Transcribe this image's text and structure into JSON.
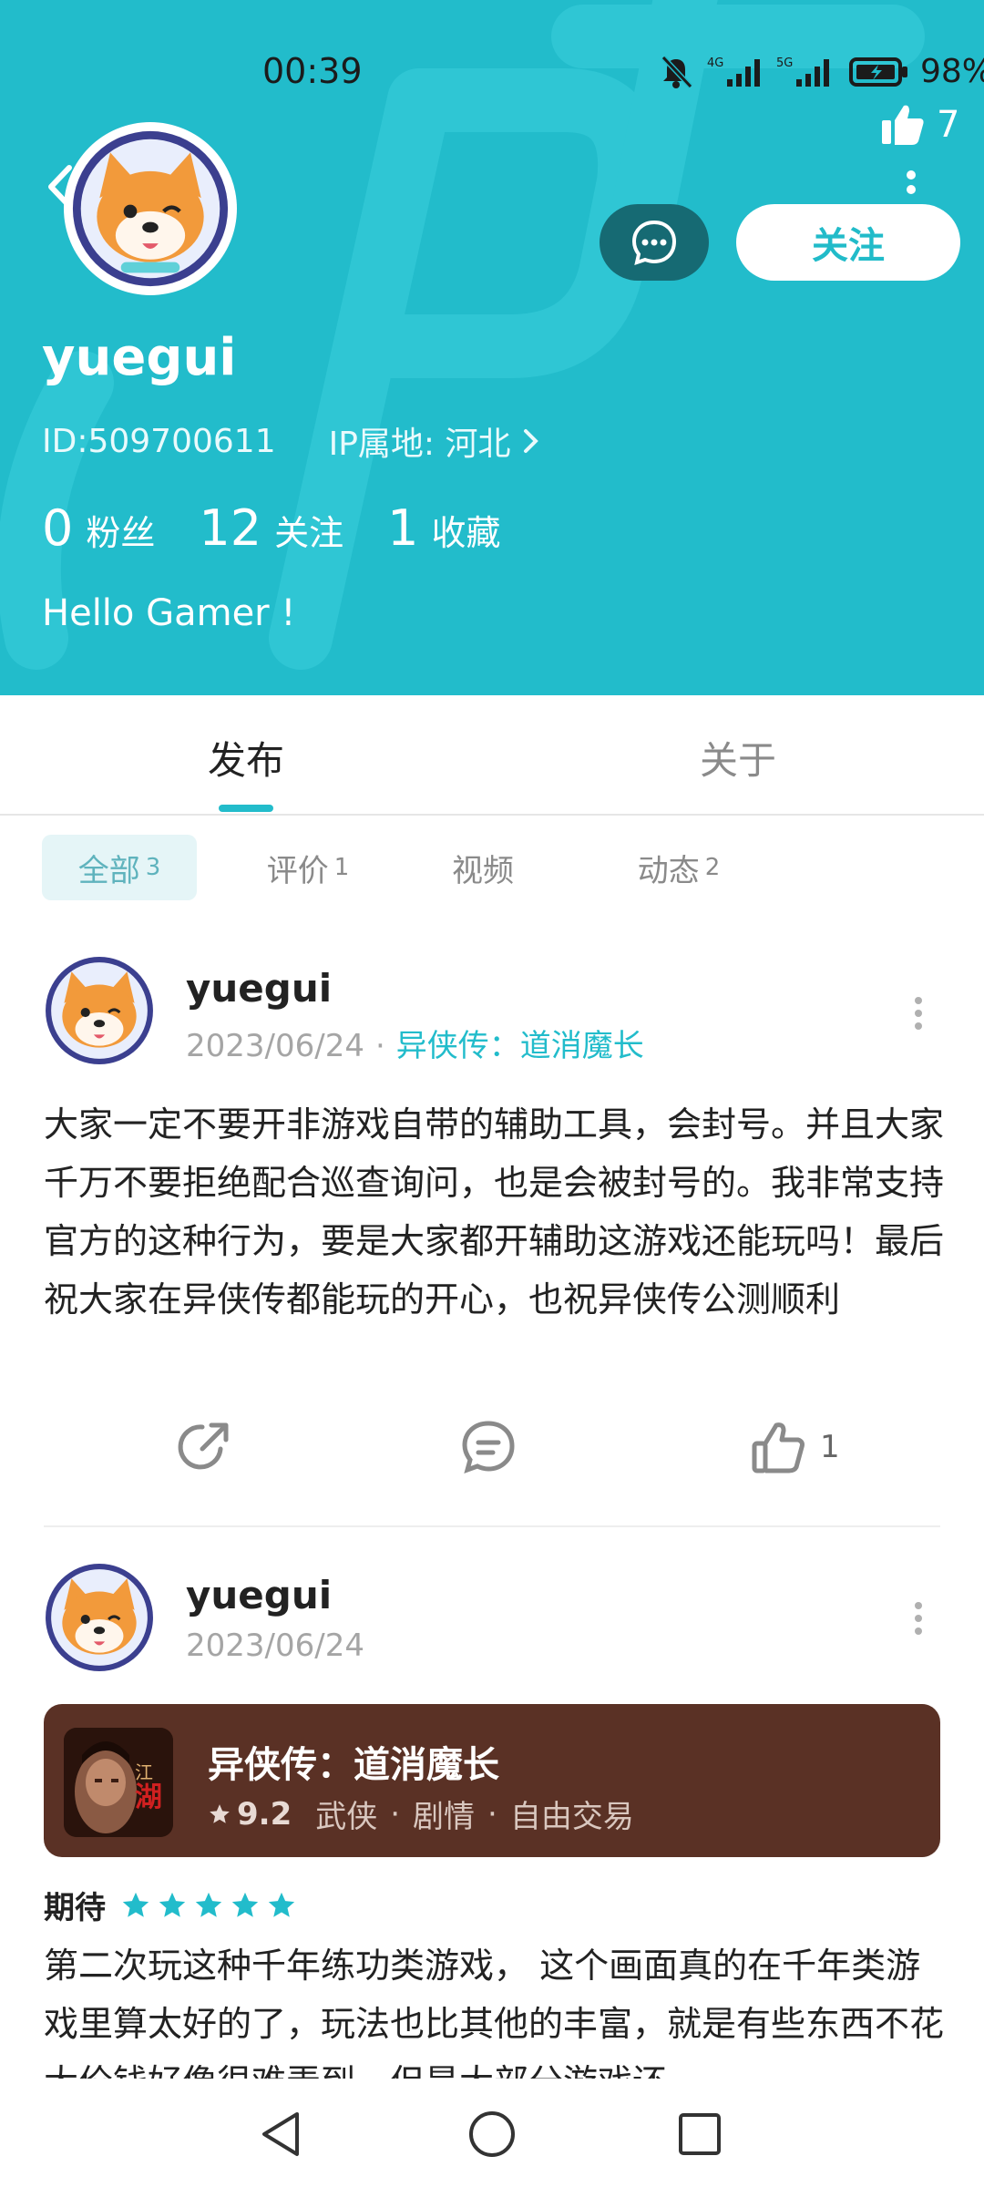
{
  "status_bar": {
    "time": "00:39",
    "battery": "98%"
  },
  "header": {
    "like_count": "7",
    "username": "yuegui",
    "id_text": "ID:509700611",
    "ip_text": "IP属地:  河北",
    "follow_label": "关注",
    "stats": [
      {
        "num": "0",
        "label": "粉丝"
      },
      {
        "num": "12",
        "label": "关注"
      },
      {
        "num": "1",
        "label": "收藏"
      }
    ],
    "bio": "Hello Gamer !",
    "accent_color": "#22bccb"
  },
  "tabs": [
    {
      "label": "发布"
    },
    {
      "label": "关于"
    }
  ],
  "filters": [
    {
      "label": "全部",
      "count": "3"
    },
    {
      "label": "评价",
      "count": "1"
    },
    {
      "label": "视频",
      "count": ""
    },
    {
      "label": "动态",
      "count": "2"
    }
  ],
  "posts": [
    {
      "author": "yuegui",
      "date": "2023/06/24",
      "game": "异侠传：道消魔长",
      "body": "大家一定不要开非游戏自带的辅助工具，会封号。并且大家千万不要拒绝配合巡查询问，也是会被封号的。我非常支持官方的这种行为，要是大家都开辅助这游戏还能玩吗！最后祝大家在异侠传都能玩的开心，也祝异侠传公测顺利",
      "likes": "1"
    },
    {
      "author": "yuegui",
      "date": "2023/06/24",
      "game_card": {
        "title": "异侠传：道消魔长",
        "score": "9.2",
        "tags": [
          "武侠",
          "剧情",
          "自由交易"
        ],
        "icon_text": "江湖"
      },
      "rating_label": "期待",
      "rating_stars": 5,
      "body": "第二次玩这种千年练功类游戏， 这个画面真的在千年类游戏里算太好的了，玩法也比其他的丰富，就是有些东西不花大价钱好像很难弄到，但是大部分游戏还"
    }
  ]
}
